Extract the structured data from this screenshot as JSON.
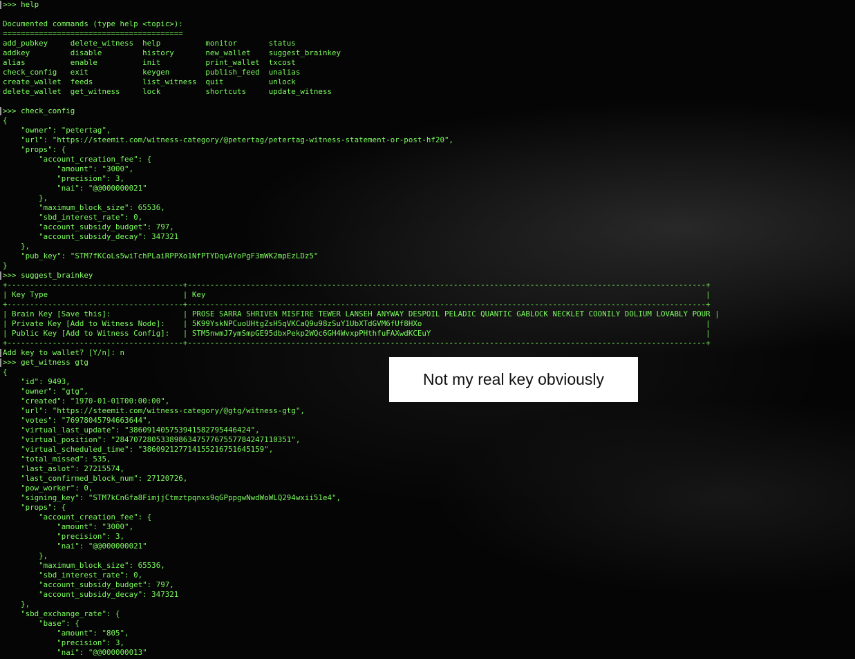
{
  "terminal": {
    "lines": [
      ">>> help",
      "",
      "Documented commands (type help <topic>):",
      "========================================",
      "add_pubkey     delete_witness  help          monitor       status",
      "addkey         disable         history       new_wallet    suggest_brainkey",
      "alias          enable          init          print_wallet  txcost",
      "check_config   exit            keygen        publish_feed  unalias",
      "create_wallet  feeds           list_witness  quit          unlock",
      "delete_wallet  get_witness     lock          shortcuts     update_witness",
      "",
      ">>> check_config",
      "{",
      "    \"owner\": \"petertag\",",
      "    \"url\": \"https://steemit.com/witness-category/@petertag/petertag-witness-statement-or-post-hf20\",",
      "    \"props\": {",
      "        \"account_creation_fee\": {",
      "            \"amount\": \"3000\",",
      "            \"precision\": 3,",
      "            \"nai\": \"@@000000021\"",
      "        },",
      "        \"maximum_block_size\": 65536,",
      "        \"sbd_interest_rate\": 0,",
      "        \"account_subsidy_budget\": 797,",
      "        \"account_subsidy_decay\": 347321",
      "    },",
      "    \"pub_key\": \"STM7fKCoLs5wiTchPLaiRPPXo1NfPTYDqvAYoPgF3mWK2mpEzLDz5\"",
      "}",
      ">>> suggest_brainkey",
      "+---------------------------------------+-------------------------------------------------------------------------------------------------------------------+",
      "| Key Type                              | Key                                                                                                               |",
      "+---------------------------------------+-------------------------------------------------------------------------------------------------------------------+",
      "| Brain Key [Save this]:                | PROSE SARRA SHRIVEN MISFIRE TEWER LANSEH ANYWAY DESPOIL PELADIC QUANTIC GABLOCK NECKLET COONILY DOLIUM LOVABLY POUR |",
      "| Private Key [Add to Witness Node]:    | 5K99YskNPCuoUHtgZsH5qVKCaQ9u98zSuY1UbXTdGVM6fUf8HXo                                                               |",
      "| Public Key [Add to Witness Config]:   | STM5nwmJ7ymSmpGE95dbxPekp2WQc6GH4WvxpPHthfuFAXwdKCEuY                                                             |",
      "+---------------------------------------+-------------------------------------------------------------------------------------------------------------------+",
      "Add key to wallet? [Y/n]: n",
      ">>> get_witness gtg",
      "{",
      "    \"id\": 9493,",
      "    \"owner\": \"gtg\",",
      "    \"created\": \"1970-01-01T00:00:00\",",
      "    \"url\": \"https://steemit.com/witness-category/@gtg/witness-gtg\",",
      "    \"votes\": \"76978045794663644\",",
      "    \"virtual_last_update\": \"386091405753941582795446424\",",
      "    \"virtual_position\": \"284707280533898634757767557784247110351\",",
      "    \"virtual_scheduled_time\": \"386092127714155216751645159\",",
      "    \"total_missed\": 535,",
      "    \"last_aslot\": 27215574,",
      "    \"last_confirmed_block_num\": 27120726,",
      "    \"pow_worker\": 0,",
      "    \"signing_key\": \"STM7kCnGfa8FimjjCtmztpqnxs9qGPppgwNwdWoWLQ294wxii51e4\",",
      "    \"props\": {",
      "        \"account_creation_fee\": {",
      "            \"amount\": \"3000\",",
      "            \"precision\": 3,",
      "            \"nai\": \"@@000000021\"",
      "        },",
      "        \"maximum_block_size\": 65536,",
      "        \"sbd_interest_rate\": 0,",
      "        \"account_subsidy_budget\": 797,",
      "        \"account_subsidy_decay\": 347321",
      "    },",
      "    \"sbd_exchange_rate\": {",
      "        \"base\": {",
      "            \"amount\": \"805\",",
      "            \"precision\": 3,",
      "            \"nai\": \"@@000000013\""
    ]
  },
  "note": {
    "text": "Not my real key obviously"
  },
  "colors": {
    "text": "#7cfc5e",
    "background": "#050505",
    "note_background": "#ffffff"
  }
}
